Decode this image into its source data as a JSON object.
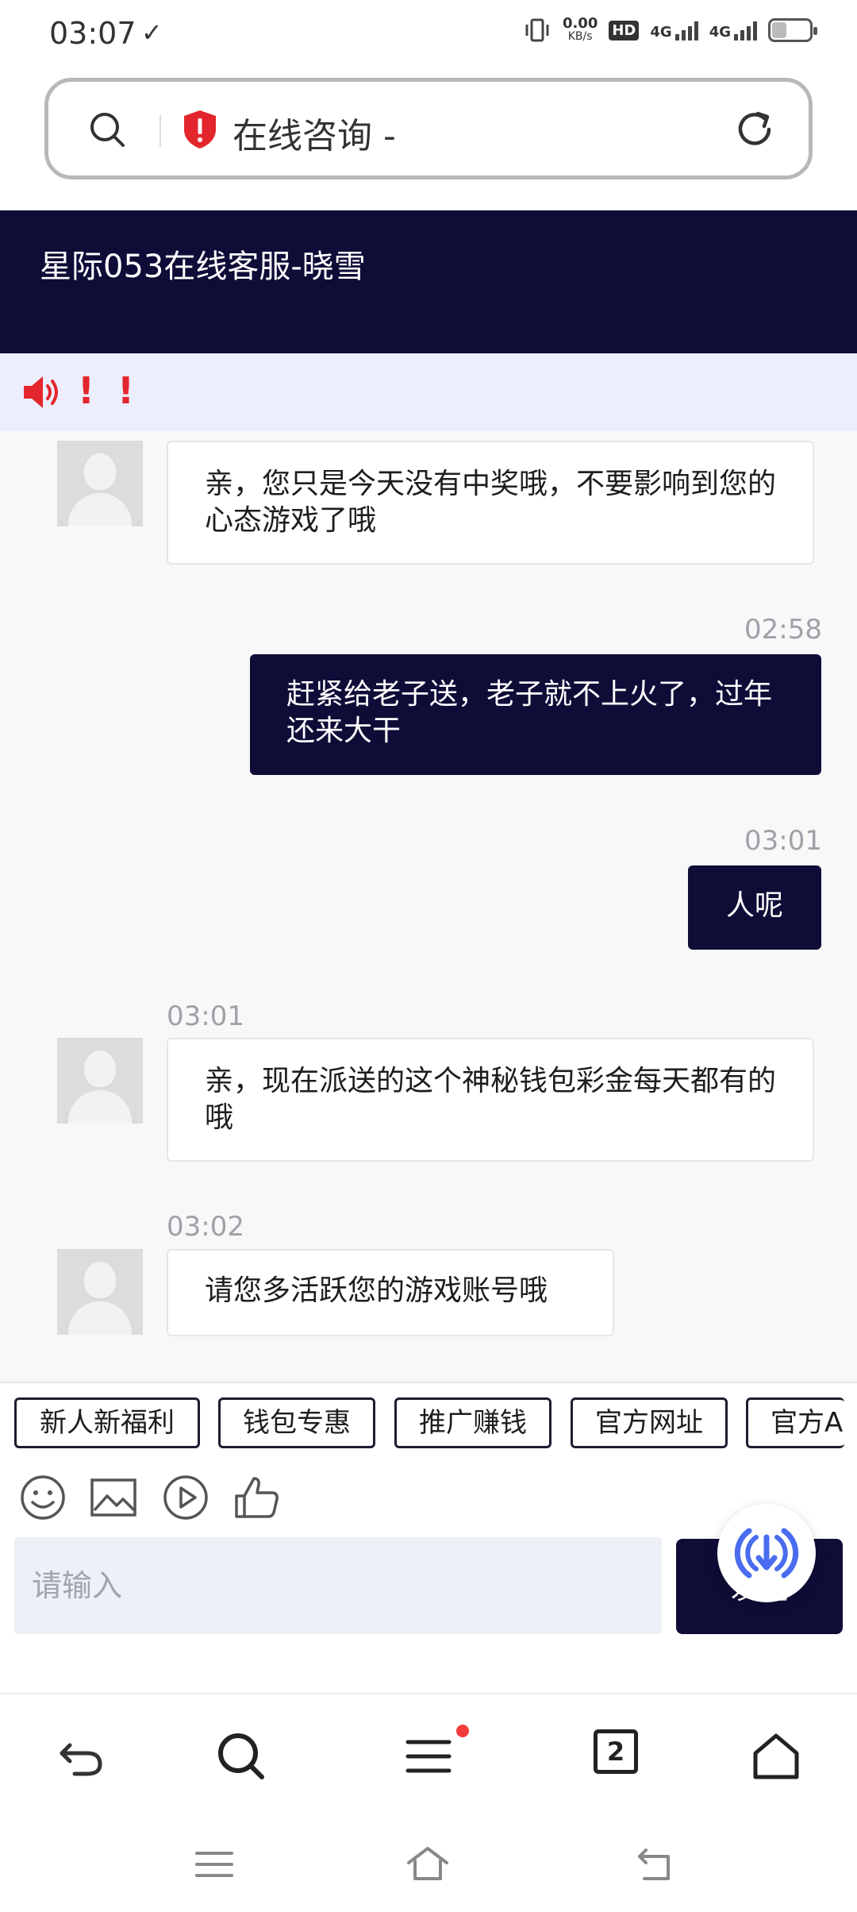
{
  "status_bar": {
    "time": "03:07",
    "net_speed": "0.00",
    "net_unit": "KB/s",
    "hd": "HD",
    "sim1": "4G",
    "sim2": "4G",
    "battery_level": 0.35
  },
  "url_bar": {
    "title": "在线咨询 -"
  },
  "chat_header": {
    "title": "星际053在线客服-晓雪"
  },
  "notice": {
    "excl1": "!",
    "excl2": "!"
  },
  "messages": [
    {
      "direction": "incoming",
      "time": "",
      "text": "亲，您只是今天没有中奖哦，不要影响到您的心态游戏了哦"
    },
    {
      "direction": "outgoing",
      "time": "02:58",
      "text": "赶紧给老子送，老子就不上火了，过年还来大干"
    },
    {
      "direction": "outgoing",
      "time": "03:01",
      "text": "人呢"
    },
    {
      "direction": "incoming",
      "time": "03:01",
      "text": "亲，现在派送的这个神秘钱包彩金每天都有的哦"
    },
    {
      "direction": "incoming",
      "time": "03:02",
      "text": "请您多活跃您的游戏账号哦"
    }
  ],
  "quick_replies": [
    "新人新福利",
    "钱包专惠",
    "推广赚钱",
    "官方网址",
    "官方A"
  ],
  "composer": {
    "placeholder": "请输入",
    "send_label": "发送"
  },
  "browser_nav": {
    "tab_count": "2"
  },
  "colors": {
    "brand_navy": "#0f0c38",
    "notice_bg": "#eceefc",
    "alert_red": "#e3262e"
  }
}
